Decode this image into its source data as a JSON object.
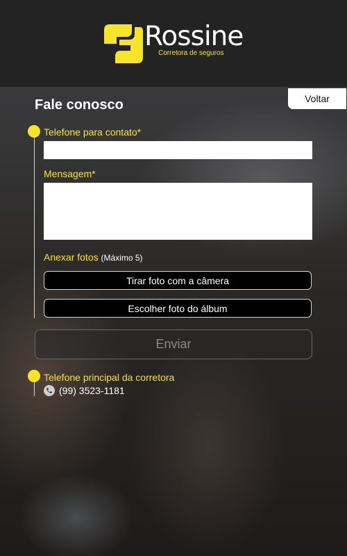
{
  "brand": {
    "name": "Rossine",
    "tagline": "Corretora de seguros",
    "accent": "#f4e526"
  },
  "nav": {
    "back_label": "Voltar"
  },
  "page": {
    "title": "Fale conosco"
  },
  "form": {
    "phone_label": "Telefone para contato*",
    "phone_value": "",
    "message_label": "Mensagem*",
    "message_value": "",
    "attach_label": "Anexar fotos",
    "attach_note": "(Máximo 5)",
    "camera_button": "Tirar foto com a câmera",
    "album_button": "Escolher foto do álbum",
    "send_button": "Enviar"
  },
  "contact": {
    "label": "Telefone principal da corretora",
    "phone": "(99) 3523-1181",
    "icon": "phone-icon"
  }
}
